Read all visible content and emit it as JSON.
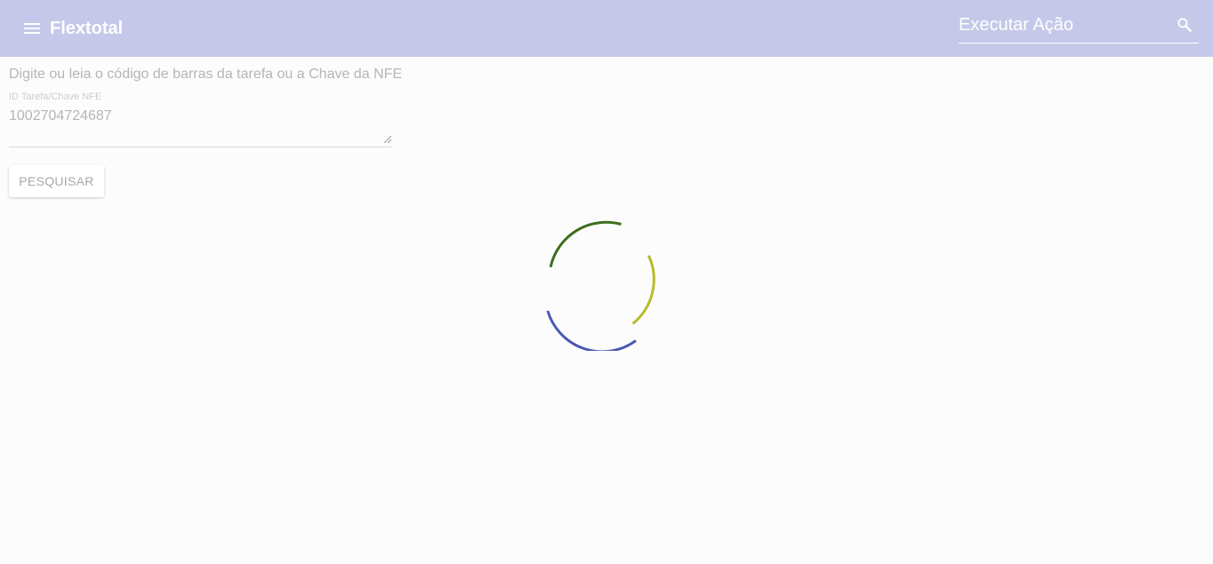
{
  "appbar": {
    "title": "Flextotal",
    "menu_icon": "menu-icon",
    "search": {
      "placeholder": "Executar Ação",
      "value": "",
      "icon": "search-icon"
    },
    "background": "#c5c8e8"
  },
  "main": {
    "instruction": "Digite ou leia o código de barras da tarefa ou a Chave da NFE",
    "field": {
      "label": "ID Tarefa/Chave NFE",
      "value": "1002704724687"
    },
    "search_button_label": "PESQUISAR"
  },
  "loading_spinner": {
    "colors": [
      "#3d6e1e",
      "#b8bb2c",
      "#4a58b4"
    ]
  }
}
